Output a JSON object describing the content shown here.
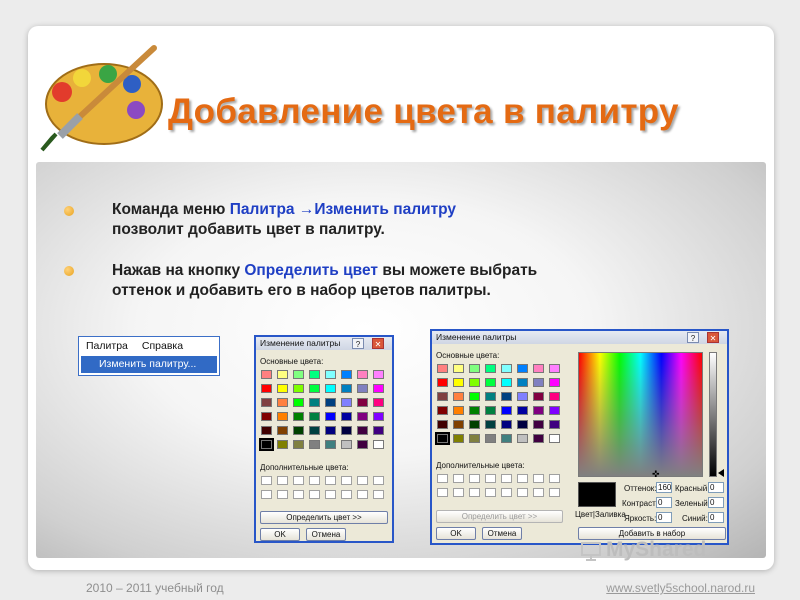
{
  "slide": {
    "title": "Добавление цвета в палитру",
    "bullets": [
      {
        "line1_prefix": "Команда меню ",
        "line1_highlight": "Палитра →Изменить палитру",
        "line2": "позволит добавить цвет в палитру."
      },
      {
        "line1_prefix": "Нажав на кнопку ",
        "line1_highlight": "Определить цвет",
        "line1_suffix": " вы можете выбрать",
        "line2": "оттенок и добавить его в набор цветов палитры."
      }
    ]
  },
  "menu": {
    "items": [
      "Палитра",
      "Справка"
    ],
    "dropdown_item": "Изменить палитру..."
  },
  "dialog_small": {
    "title": "Изменение палитры",
    "help": "?",
    "close": "✕",
    "basic_colors_label": "Основные цвета:",
    "custom_colors_label": "Дополнительные цвета:",
    "define_button": "Определить цвет >>",
    "ok_button": "OK",
    "cancel_button": "Отмена"
  },
  "dialog_large": {
    "title": "Изменение палитры",
    "help": "?",
    "close": "✕",
    "basic_colors_label": "Основные цвета:",
    "custom_colors_label": "Дополнительные цвета:",
    "define_button": "Определить цвет >>",
    "ok_button": "OK",
    "cancel_button": "Отмена",
    "preview_label": "Цвет|Заливка",
    "fields": [
      {
        "label": "Оттенок:",
        "value": "160"
      },
      {
        "label": "Контраст:",
        "value": "0"
      },
      {
        "label": "Яркость:",
        "value": "0"
      },
      {
        "label": "Красный:",
        "value": "0"
      },
      {
        "label": "Зеленый:",
        "value": "0"
      },
      {
        "label": "Синий:",
        "value": "0"
      }
    ],
    "add_button": "Добавить в набор"
  },
  "basic_colors": [
    "#ff8080",
    "#ffff80",
    "#80ff80",
    "#00ff80",
    "#80ffff",
    "#0080ff",
    "#ff80c0",
    "#ff80ff",
    "#ff0000",
    "#ffff00",
    "#80ff00",
    "#00ff40",
    "#00ffff",
    "#0080c0",
    "#8080c0",
    "#ff00ff",
    "#804040",
    "#ff8040",
    "#00ff00",
    "#008080",
    "#004080",
    "#8080ff",
    "#800040",
    "#ff0080",
    "#800000",
    "#ff8000",
    "#008000",
    "#008040",
    "#0000ff",
    "#0000a0",
    "#800080",
    "#8000ff",
    "#400000",
    "#804000",
    "#004000",
    "#004040",
    "#000080",
    "#000040",
    "#400040",
    "#400080",
    "#000000",
    "#808000",
    "#808040",
    "#808080",
    "#408080",
    "#c0c0c0",
    "#400040",
    "#ffffff"
  ],
  "footer": {
    "year": "2010 – 2011 учебный год",
    "site": "www.svetly5school.narod.ru"
  },
  "watermark": "MyShared"
}
